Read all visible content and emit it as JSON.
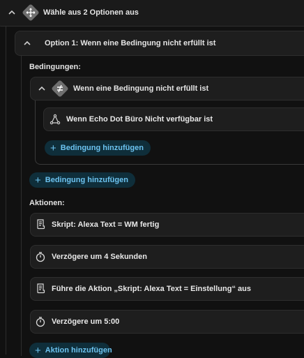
{
  "header": {
    "title": "Wähle aus 2 Optionen aus",
    "icon": "choose-icon"
  },
  "option1": {
    "title": "Option 1: Wenn eine Bedingung nicht erfüllt ist",
    "conditions_label": "Bedingungen:",
    "condition": {
      "title": "Wenn eine Bedingung nicht erfüllt ist",
      "icon": "not-equal-icon",
      "sub_condition": "Wenn Echo Dot Büro Nicht verfügbar ist",
      "sub_icon": "device-graph-icon",
      "inner_add_label": "Bedingung hinzufügen"
    },
    "add_condition_label": "Bedingung hinzufügen",
    "actions_label": "Aktionen:",
    "actions": [
      {
        "icon": "script-icon",
        "label": "Skript: Alexa Text = WM fertig"
      },
      {
        "icon": "timer-icon",
        "label": "Verzögere um 4 Sekunden"
      },
      {
        "icon": "script-icon",
        "label": "Führe die Aktion „Skript: Alexa Text = Einstellung“ aus"
      },
      {
        "icon": "timer-icon",
        "label": "Verzögere um 5:00"
      }
    ],
    "add_action_label": "Aktion hinzufügen"
  }
}
